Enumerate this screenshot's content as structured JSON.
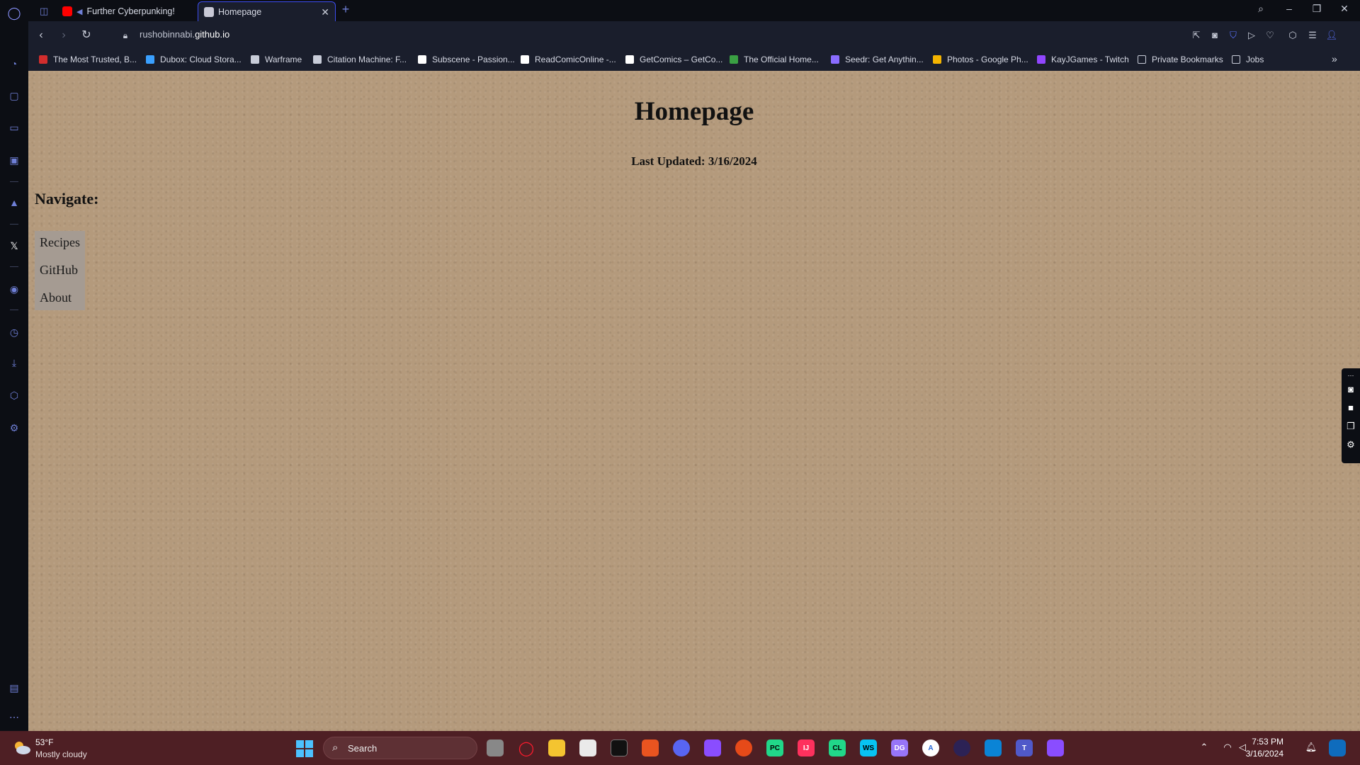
{
  "browser": {
    "tabs": [
      {
        "title": "Further Cyberpunking!",
        "favicon_color": "#ff0000",
        "active": false
      },
      {
        "title": "Homepage",
        "favicon_color": "#c9c9d6",
        "active": true
      }
    ],
    "new_tab_symbol": "+",
    "url_prefix": "rushobinnabi.",
    "url_domain": "github.io",
    "bookmarks": [
      {
        "label": "The Most Trusted, B...",
        "color": "#d22d2d"
      },
      {
        "label": "Dubox: Cloud Stora...",
        "color": "#3aa0ff"
      },
      {
        "label": "Warframe",
        "color": "#c8ccd8"
      },
      {
        "label": "Citation Machine: F...",
        "color": "#c8ccd8"
      },
      {
        "label": "Subscene - Passion...",
        "color": "#ffffff"
      },
      {
        "label": "ReadComicOnline -...",
        "color": "#ffffff"
      },
      {
        "label": "GetComics – GetCo...",
        "color": "#ffffff"
      },
      {
        "label": "The Official Home...",
        "color": "#3aa043"
      },
      {
        "label": "Seedr: Get Anythin...",
        "color": "#8a6cff"
      },
      {
        "label": "Photos - Google Ph...",
        "color": "#f4b400"
      },
      {
        "label": "KayJGames - Twitch",
        "color": "#9146ff"
      },
      {
        "label": "Private Bookmarks",
        "color": "#c8ccd8"
      },
      {
        "label": "Jobs",
        "color": "#c8ccd8"
      }
    ],
    "bookmarks_more": "»"
  },
  "page": {
    "title": "Homepage",
    "last_updated": "Last Updated: 3/16/2024",
    "navigate_heading": "Navigate:",
    "nav_links": [
      "Recipes",
      "GitHub",
      "About"
    ]
  },
  "taskbar": {
    "weather_temp": "53°F",
    "weather_desc": "Mostly cloudy",
    "search_placeholder": "Search",
    "time": "7:53 PM",
    "date": "3/16/2024"
  },
  "colors": {
    "page_background": "#b49a7c",
    "nav_box": "#a59b92",
    "taskbar": "#4e1f24",
    "accent": "#3d4df0"
  }
}
